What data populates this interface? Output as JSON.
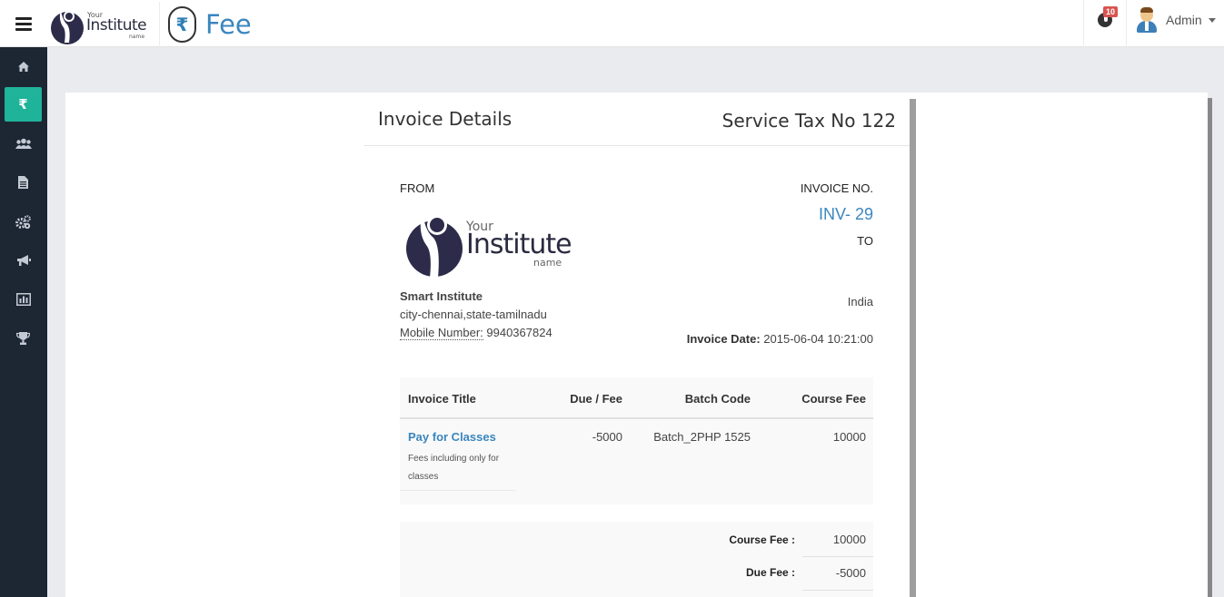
{
  "header": {
    "brand": {
      "your": "Your",
      "institute": "Institute",
      "name": "name"
    },
    "page_title": "Fee",
    "page_icon": "rupee-icon",
    "notifications_count": "10",
    "user_name": "Admin"
  },
  "sidebar": {
    "items": [
      {
        "name": "home",
        "icon": "home-icon",
        "active": false
      },
      {
        "name": "fee",
        "icon": "rupee-icon",
        "glyph": "₹",
        "active": true
      },
      {
        "name": "users",
        "icon": "users-icon",
        "active": false
      },
      {
        "name": "documents",
        "icon": "document-icon",
        "active": false
      },
      {
        "name": "settings",
        "icon": "gears-icon",
        "active": false
      },
      {
        "name": "announcements",
        "icon": "megaphone-icon",
        "active": false
      },
      {
        "name": "reports",
        "icon": "bar-chart-icon",
        "active": false
      },
      {
        "name": "achievements",
        "icon": "trophy-icon",
        "active": false
      }
    ]
  },
  "invoice": {
    "title": "Invoice Details",
    "service_tax": "Service Tax No 122",
    "from_label": "FROM",
    "invoice_no_label": "INVOICE NO.",
    "invoice_no": "INV- 29",
    "to_label": "TO",
    "logo": {
      "your": "Your",
      "institute": "Institute",
      "name": "name"
    },
    "org_name": "Smart Institute",
    "org_address": "city-chennai,state-tamilnadu",
    "mobile_label": "Mobile Number:",
    "mobile_value": " 9940367824",
    "to_country": "India",
    "date_label": "Invoice Date:",
    "date_value": " 2015-06-04 10:21:00",
    "table": {
      "headers": [
        "Invoice Title",
        "Due / Fee",
        "Batch Code",
        "Course Fee"
      ],
      "rows": [
        {
          "title": "Pay for Classes",
          "description": "Fees including only for classes",
          "due": "-5000",
          "batch": "Batch_2PHP 1525",
          "course_fee": "10000"
        }
      ]
    },
    "totals": {
      "course_fee_label": "Course Fee :",
      "course_fee_value": "10000",
      "due_fee_label": "Due Fee :",
      "due_fee_value": "-5000"
    }
  },
  "colors": {
    "sidebar_bg": "#1d2633",
    "active_item": "#1fb39a",
    "link_blue": "#3a86bf",
    "badge_red": "#d9534f"
  }
}
